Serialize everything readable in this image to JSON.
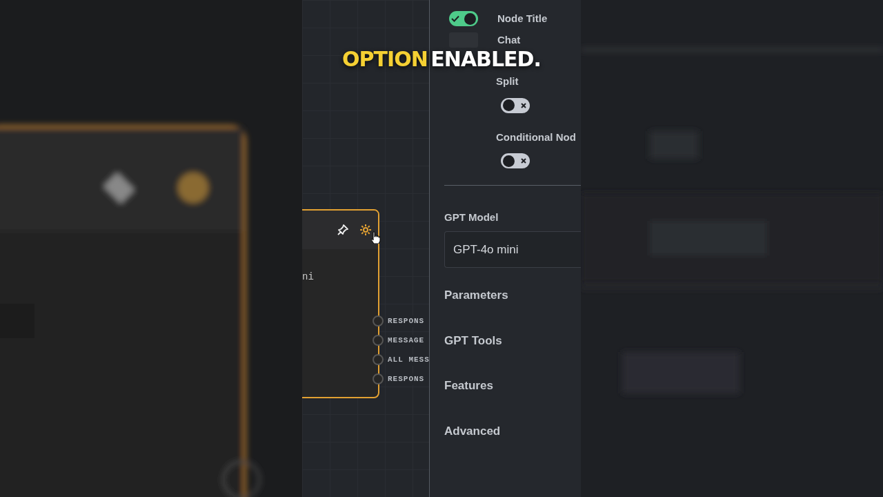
{
  "caption": [
    {
      "text": "OPTION",
      "color": "#f5d033"
    },
    {
      "text": "ENABLED.",
      "color": "#ffffff"
    }
  ],
  "canvas": {
    "node": {
      "body_text": "ni",
      "selected": true,
      "ports": [
        {
          "label": "RESPONS"
        },
        {
          "label": "MESSAGE"
        },
        {
          "label": "ALL MESS"
        },
        {
          "label": "RESPONS"
        }
      ]
    }
  },
  "panel": {
    "toggles": [
      {
        "kind": "inline",
        "label": "Node Title",
        "on": true,
        "disabled": false
      },
      {
        "kind": "inline",
        "label": "Chat",
        "on": false,
        "disabled": true
      },
      {
        "kind": "stacked",
        "label": "Split",
        "on": false,
        "disabled": false
      },
      {
        "kind": "stacked",
        "label": "Conditional Nod",
        "on": false,
        "disabled": false
      }
    ],
    "model": {
      "label": "GPT Model",
      "value": "GPT-4o mini"
    },
    "sections": [
      {
        "label": "Parameters"
      },
      {
        "label": "GPT Tools"
      },
      {
        "label": "Features"
      },
      {
        "label": "Advanced"
      }
    ]
  }
}
